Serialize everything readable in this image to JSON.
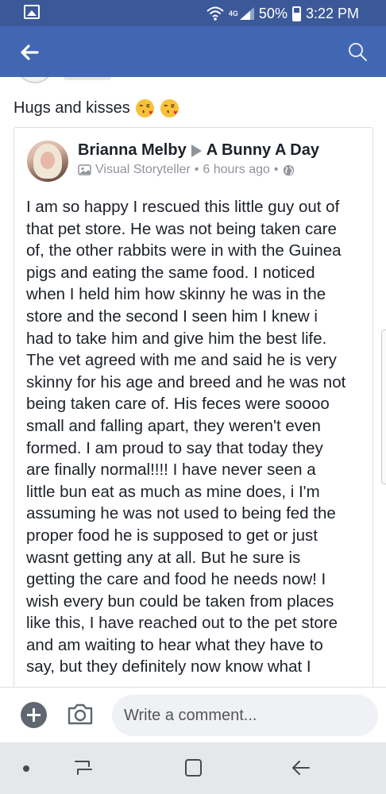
{
  "status_bar": {
    "network": "4G",
    "battery_percent": "50%",
    "time": "3:22 PM"
  },
  "app_bar": {
    "back_icon": "arrow-left-icon",
    "search_icon": "search-icon"
  },
  "comment": {
    "text": "Hugs and kisses",
    "emojis": [
      "face-blowing-kiss-emoji",
      "face-blowing-kiss-emoji"
    ]
  },
  "shared_post": {
    "author": "Brianna Melby",
    "target": "A Bunny A Day",
    "badge": "Visual Storyteller",
    "time_ago": "6 hours ago",
    "separator": "•",
    "privacy_icon": "globe-icon",
    "body_lines": [
      "I am so happy I rescued this little guy out of",
      "that  pet store. He was not being taken care",
      "of, the other rabbits were in with the Guinea",
      "pigs and eating the same food. I noticed",
      "when I held him how skinny he was in the",
      "store and the second I seen him I knew i",
      "had to take him and give him the best life.",
      "The vet agreed with me and said he is very",
      "skinny for his age and breed and he was not",
      "being taken care of. His feces were soooo",
      "small and falling apart, they weren't even",
      "formed. I am proud to say that today they",
      "are finally normal!!!! I have never seen a",
      "little bun eat as much as mine does, i I'm",
      "assuming he was not used to being fed the",
      "proper food he is supposed to get or just",
      "wasnt getting any at all. But he sure is",
      "getting the care and food he needs now! I",
      "wish every bun could be taken from places",
      "like this, I have reached out to the pet store",
      "and am waiting to hear what they have to",
      "say, but they definitely now know what I"
    ]
  },
  "composer": {
    "placeholder": "Write a comment..."
  },
  "colors": {
    "facebook_blue": "#4267b2",
    "status_blue": "#3b5998",
    "text_primary": "#1d2129",
    "text_secondary": "#90949c"
  }
}
